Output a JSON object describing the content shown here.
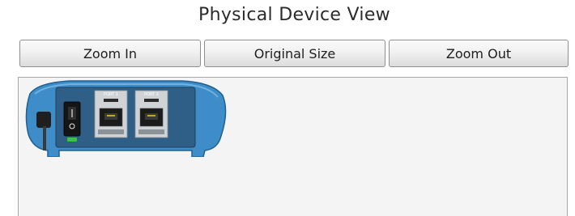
{
  "header": {
    "title": "Physical Device View"
  },
  "toolbar": {
    "zoom_in_label": "Zoom In",
    "original_size_label": "Original Size",
    "zoom_out_label": "Zoom Out"
  },
  "device": {
    "port_labels": [
      "PORT 1",
      "PORT 2"
    ],
    "body_color": "#3e8dc9",
    "panel_color": "#2f5f86",
    "power_led_color": "#37c24a"
  }
}
